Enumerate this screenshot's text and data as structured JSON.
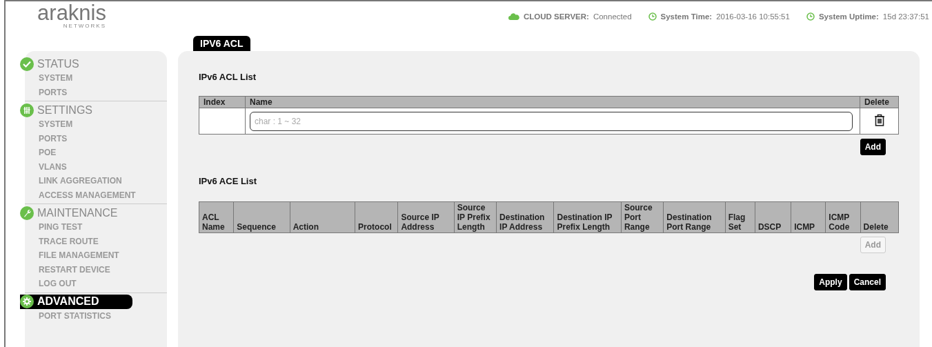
{
  "logo": {
    "name": "araknis",
    "tagline": "NETWORKS"
  },
  "header_status": [
    {
      "kind": "cloud",
      "label": "CLOUD SERVER:",
      "value": "Connected"
    },
    {
      "kind": "clock",
      "label": "System Time:",
      "value": "2016-03-16 10:55:51"
    },
    {
      "kind": "clock",
      "label": "System Uptime:",
      "value": "15d 23:37:51"
    }
  ],
  "tab": {
    "label": "IPV6 ACL",
    "selected": true
  },
  "sidebar": [
    {
      "title": "STATUS",
      "kind": "check",
      "selected": false,
      "items": [
        "SYSTEM",
        "PORTS"
      ]
    },
    {
      "title": "SETTINGS",
      "kind": "sliders",
      "selected": false,
      "items": [
        "SYSTEM",
        "PORTS",
        "POE",
        "VLANS",
        "LINK AGGREGATION",
        "ACCESS MANAGEMENT"
      ]
    },
    {
      "title": "MAINTENANCE",
      "kind": "wrench",
      "selected": false,
      "items": [
        "PING TEST",
        "TRACE ROUTE",
        "FILE MANAGEMENT",
        "RESTART DEVICE",
        "LOG OUT"
      ]
    },
    {
      "title": "ADVANCED",
      "kind": "gear",
      "selected": true,
      "items": [
        "PORT STATISTICS"
      ]
    }
  ],
  "acl_list": {
    "title": "IPv6 ACL List",
    "columns": [
      "Index",
      "Name",
      "Delete"
    ],
    "rows": [
      {
        "index": "",
        "name": {
          "placeholder": "char : 1 ~ 32"
        }
      }
    ],
    "add_button": {
      "label": "Add",
      "disabled": false
    }
  },
  "ace_list": {
    "title": "IPv6 ACE List",
    "columns": [
      "ACL Name",
      "Sequence",
      "Action",
      "Protocol",
      "Source IP Address",
      "Source IP Prefix Length",
      "Destination IP Address",
      "Destination IP Prefix Length",
      "Source Port Range",
      "Destination Port Range",
      "Flag Set",
      "DSCP",
      "ICMP",
      "ICMP Code",
      "Delete"
    ],
    "add_button": {
      "label": "Add",
      "disabled": true
    }
  },
  "buttons": [
    {
      "label": "Apply",
      "disabled": false
    },
    {
      "label": "Cancel",
      "disabled": false
    }
  ]
}
